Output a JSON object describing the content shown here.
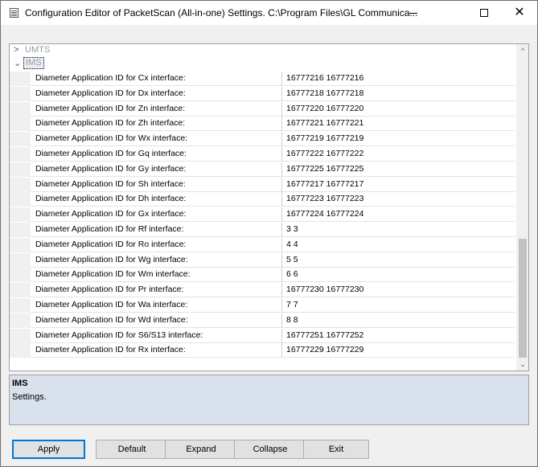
{
  "window": {
    "title": "Configuration Editor of PacketScan (All-in-one) Settings. C:\\Program Files\\GL Communica...",
    "minimize_glyph": "",
    "maximize_glyph": "",
    "close_glyph": "✕"
  },
  "grid": {
    "categories": [
      {
        "label": "UMTS",
        "chevron": ">"
      },
      {
        "label": "IMS",
        "chevron": "⌄"
      }
    ],
    "rows": [
      {
        "name": "Diameter Application ID for Cx interface:",
        "value": "16777216 16777216"
      },
      {
        "name": "Diameter Application ID for Dx interface:",
        "value": "16777218 16777218"
      },
      {
        "name": "Diameter Application ID for Zn interface:",
        "value": "16777220 16777220"
      },
      {
        "name": "Diameter Application ID for Zh interface:",
        "value": "16777221 16777221"
      },
      {
        "name": "Diameter Application ID for Wx interface:",
        "value": "16777219 16777219"
      },
      {
        "name": "Diameter Application ID for Gq interface:",
        "value": "16777222 16777222"
      },
      {
        "name": "Diameter Application ID for Gy interface:",
        "value": "16777225 16777225"
      },
      {
        "name": "Diameter Application ID for Sh interface:",
        "value": "16777217 16777217"
      },
      {
        "name": "Diameter Application ID for Dh interface:",
        "value": "16777223 16777223"
      },
      {
        "name": "Diameter Application ID for Gx interface:",
        "value": "16777224 16777224"
      },
      {
        "name": "Diameter Application ID for Rf interface:",
        "value": "3 3"
      },
      {
        "name": "Diameter Application ID for Ro interface:",
        "value": "4 4"
      },
      {
        "name": "Diameter Application ID for Wg interface:",
        "value": "5 5"
      },
      {
        "name": "Diameter Application ID for Wm interface:",
        "value": "6 6"
      },
      {
        "name": "Diameter Application ID for Pr interface:",
        "value": "16777230 16777230"
      },
      {
        "name": "Diameter Application ID for Wa interface:",
        "value": "7 7"
      },
      {
        "name": "Diameter Application ID for Wd interface:",
        "value": "8 8"
      },
      {
        "name": "Diameter Application ID for S6/S13 interface:",
        "value": "16777251 16777252"
      },
      {
        "name": "Diameter Application ID for Rx interface:",
        "value": "16777229 16777229"
      }
    ],
    "scroll_up_glyph": "^",
    "scroll_down_glyph": "⌄"
  },
  "description": {
    "title": "IMS",
    "text": "Settings."
  },
  "buttons": {
    "apply": "Apply",
    "default": "Default",
    "expand": "Expand",
    "collapse": "Collapse",
    "exit": "Exit"
  },
  "colors": {
    "accent_focus": "#0078d7",
    "description_bg": "#d9e2ec",
    "category_text": "#9a9a9a"
  }
}
